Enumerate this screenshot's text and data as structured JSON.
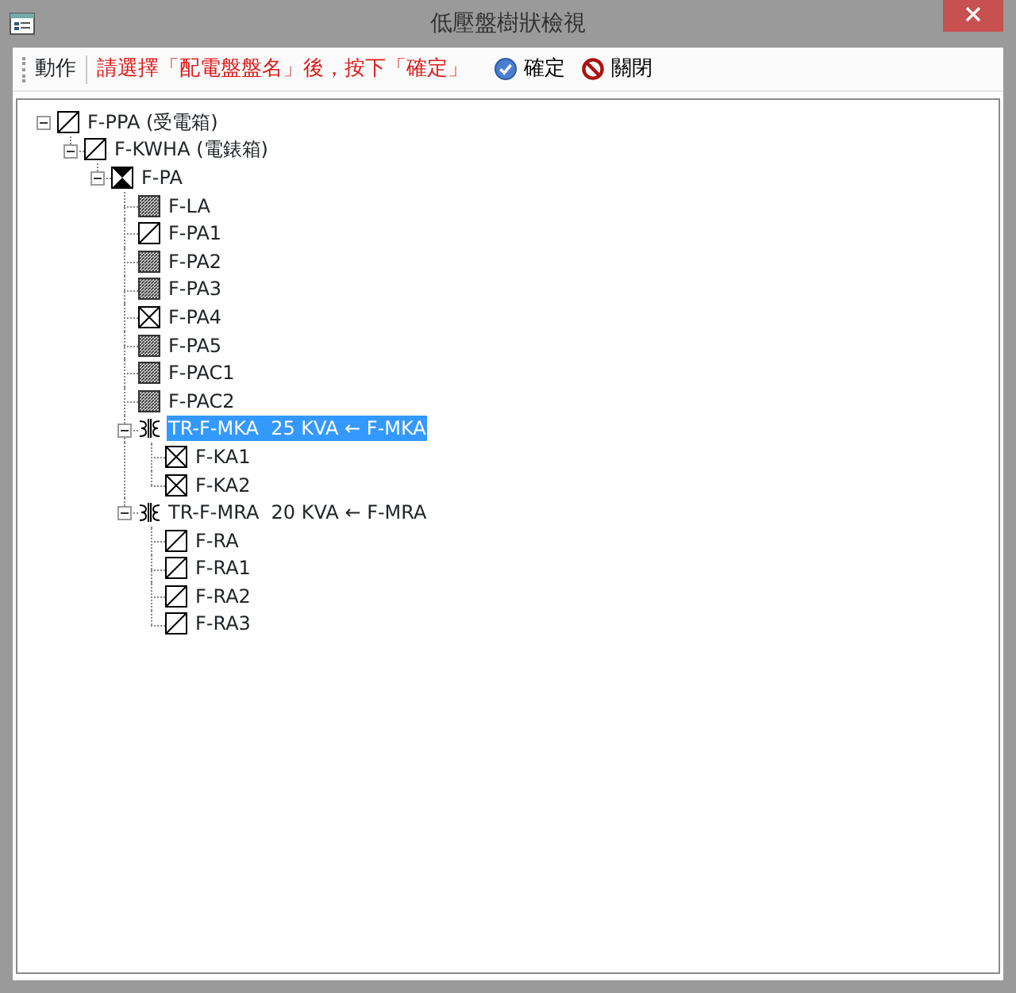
{
  "window": {
    "title": "低壓盤樹狀檢視"
  },
  "toolbar": {
    "label": "動作",
    "instruction": "請選擇「配電盤盤名」後，按下「確定」",
    "buttons": [
      {
        "kind": "confirm",
        "label": "確定"
      },
      {
        "kind": "close",
        "label": "關閉"
      }
    ]
  },
  "tree": [
    {
      "label": "F-PPA (受電箱)",
      "kind": "slash",
      "selected": false,
      "expanded": true,
      "children": [
        {
          "label": "F-KWHA (電錶箱)",
          "kind": "slash",
          "selected": false,
          "expanded": true,
          "children": [
            {
              "label": "F-PA",
              "kind": "bowtie",
              "selected": false,
              "expanded": true,
              "children": [
                {
                  "label": "F-LA",
                  "kind": "hatched",
                  "selected": false
                },
                {
                  "label": "F-PA1",
                  "kind": "slash",
                  "selected": false
                },
                {
                  "label": "F-PA2",
                  "kind": "hatched",
                  "selected": false
                },
                {
                  "label": "F-PA3",
                  "kind": "hatched",
                  "selected": false
                },
                {
                  "label": "F-PA4",
                  "kind": "cross",
                  "selected": false
                },
                {
                  "label": "F-PA5",
                  "kind": "hatched",
                  "selected": false
                },
                {
                  "label": "F-PAC1",
                  "kind": "hatched",
                  "selected": false
                },
                {
                  "label": "F-PAC2",
                  "kind": "hatched",
                  "selected": false
                },
                {
                  "label": "TR-F-MKA  25 KVA ← F-MKA",
                  "kind": "transformer",
                  "selected": true,
                  "expanded": true,
                  "children": [
                    {
                      "label": "F-KA1",
                      "kind": "cross",
                      "selected": false
                    },
                    {
                      "label": "F-KA2",
                      "kind": "cross",
                      "selected": false
                    }
                  ]
                },
                {
                  "label": "TR-F-MRA  20 KVA ← F-MRA",
                  "kind": "transformer",
                  "selected": false,
                  "expanded": true,
                  "children": [
                    {
                      "label": "F-RA",
                      "kind": "slash",
                      "selected": false
                    },
                    {
                      "label": "F-RA1",
                      "kind": "slash",
                      "selected": false
                    },
                    {
                      "label": "F-RA2",
                      "kind": "slash",
                      "selected": false
                    },
                    {
                      "label": "F-RA3",
                      "kind": "slash",
                      "selected": false
                    }
                  ]
                }
              ]
            }
          ]
        }
      ]
    }
  ]
}
